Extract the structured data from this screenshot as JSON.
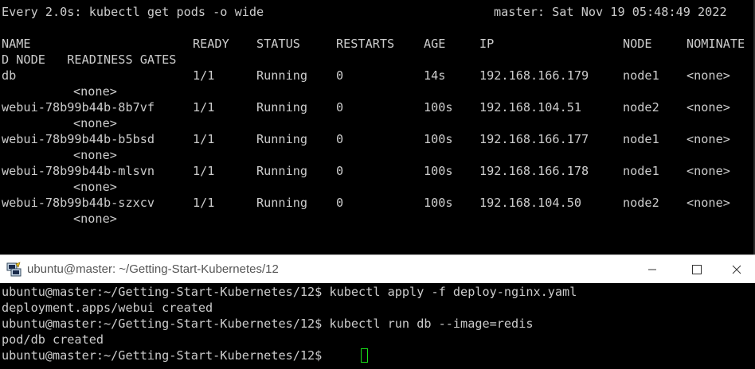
{
  "top_terminal": {
    "header_left": "Every 2.0s: kubectl get pods -o wide",
    "header_right": "master: Sat Nov 19 05:48:49 2022",
    "columns": [
      "NAME",
      "READY",
      "STATUS",
      "RESTARTS",
      "AGE",
      "IP",
      "NODE",
      "NOMINATE"
    ],
    "columns_wrap": "D NODE   READINESS GATES",
    "rows": [
      {
        "name": "db",
        "ready": "1/1",
        "status": "Running",
        "restarts": "0",
        "age": "14s",
        "ip": "192.168.166.179",
        "node": "node1",
        "nominated": "<none>",
        "gates": "<none>"
      },
      {
        "name": "webui-78b99b44b-8b7vf",
        "ready": "1/1",
        "status": "Running",
        "restarts": "0",
        "age": "100s",
        "ip": "192.168.104.51",
        "node": "node2",
        "nominated": "<none>",
        "gates": "<none>"
      },
      {
        "name": "webui-78b99b44b-b5bsd",
        "ready": "1/1",
        "status": "Running",
        "restarts": "0",
        "age": "100s",
        "ip": "192.168.166.177",
        "node": "node1",
        "nominated": "<none>",
        "gates": "<none>"
      },
      {
        "name": "webui-78b99b44b-mlsvn",
        "ready": "1/1",
        "status": "Running",
        "restarts": "0",
        "age": "100s",
        "ip": "192.168.166.178",
        "node": "node1",
        "nominated": "<none>",
        "gates": "<none>"
      },
      {
        "name": "webui-78b99b44b-szxcv",
        "ready": "1/1",
        "status": "Running",
        "restarts": "0",
        "age": "100s",
        "ip": "192.168.104.50",
        "node": "node2",
        "nominated": "<none>",
        "gates": "<none>"
      }
    ]
  },
  "window": {
    "title": "ubuntu@master: ~/Getting-Start-Kubernetes/12",
    "icon": "putty-icon",
    "buttons": [
      "minimize-icon",
      "maximize-icon",
      "close-icon"
    ]
  },
  "bottom_terminal": {
    "lines": [
      "ubuntu@master:~/Getting-Start-Kubernetes/12$ kubectl apply -f deploy-nginx.yaml",
      "deployment.apps/webui created",
      "ubuntu@master:~/Getting-Start-Kubernetes/12$ kubectl run db --image=redis",
      "pod/db created",
      "ubuntu@master:~/Getting-Start-Kubernetes/12$ "
    ],
    "cursor_color": "#18e018"
  }
}
